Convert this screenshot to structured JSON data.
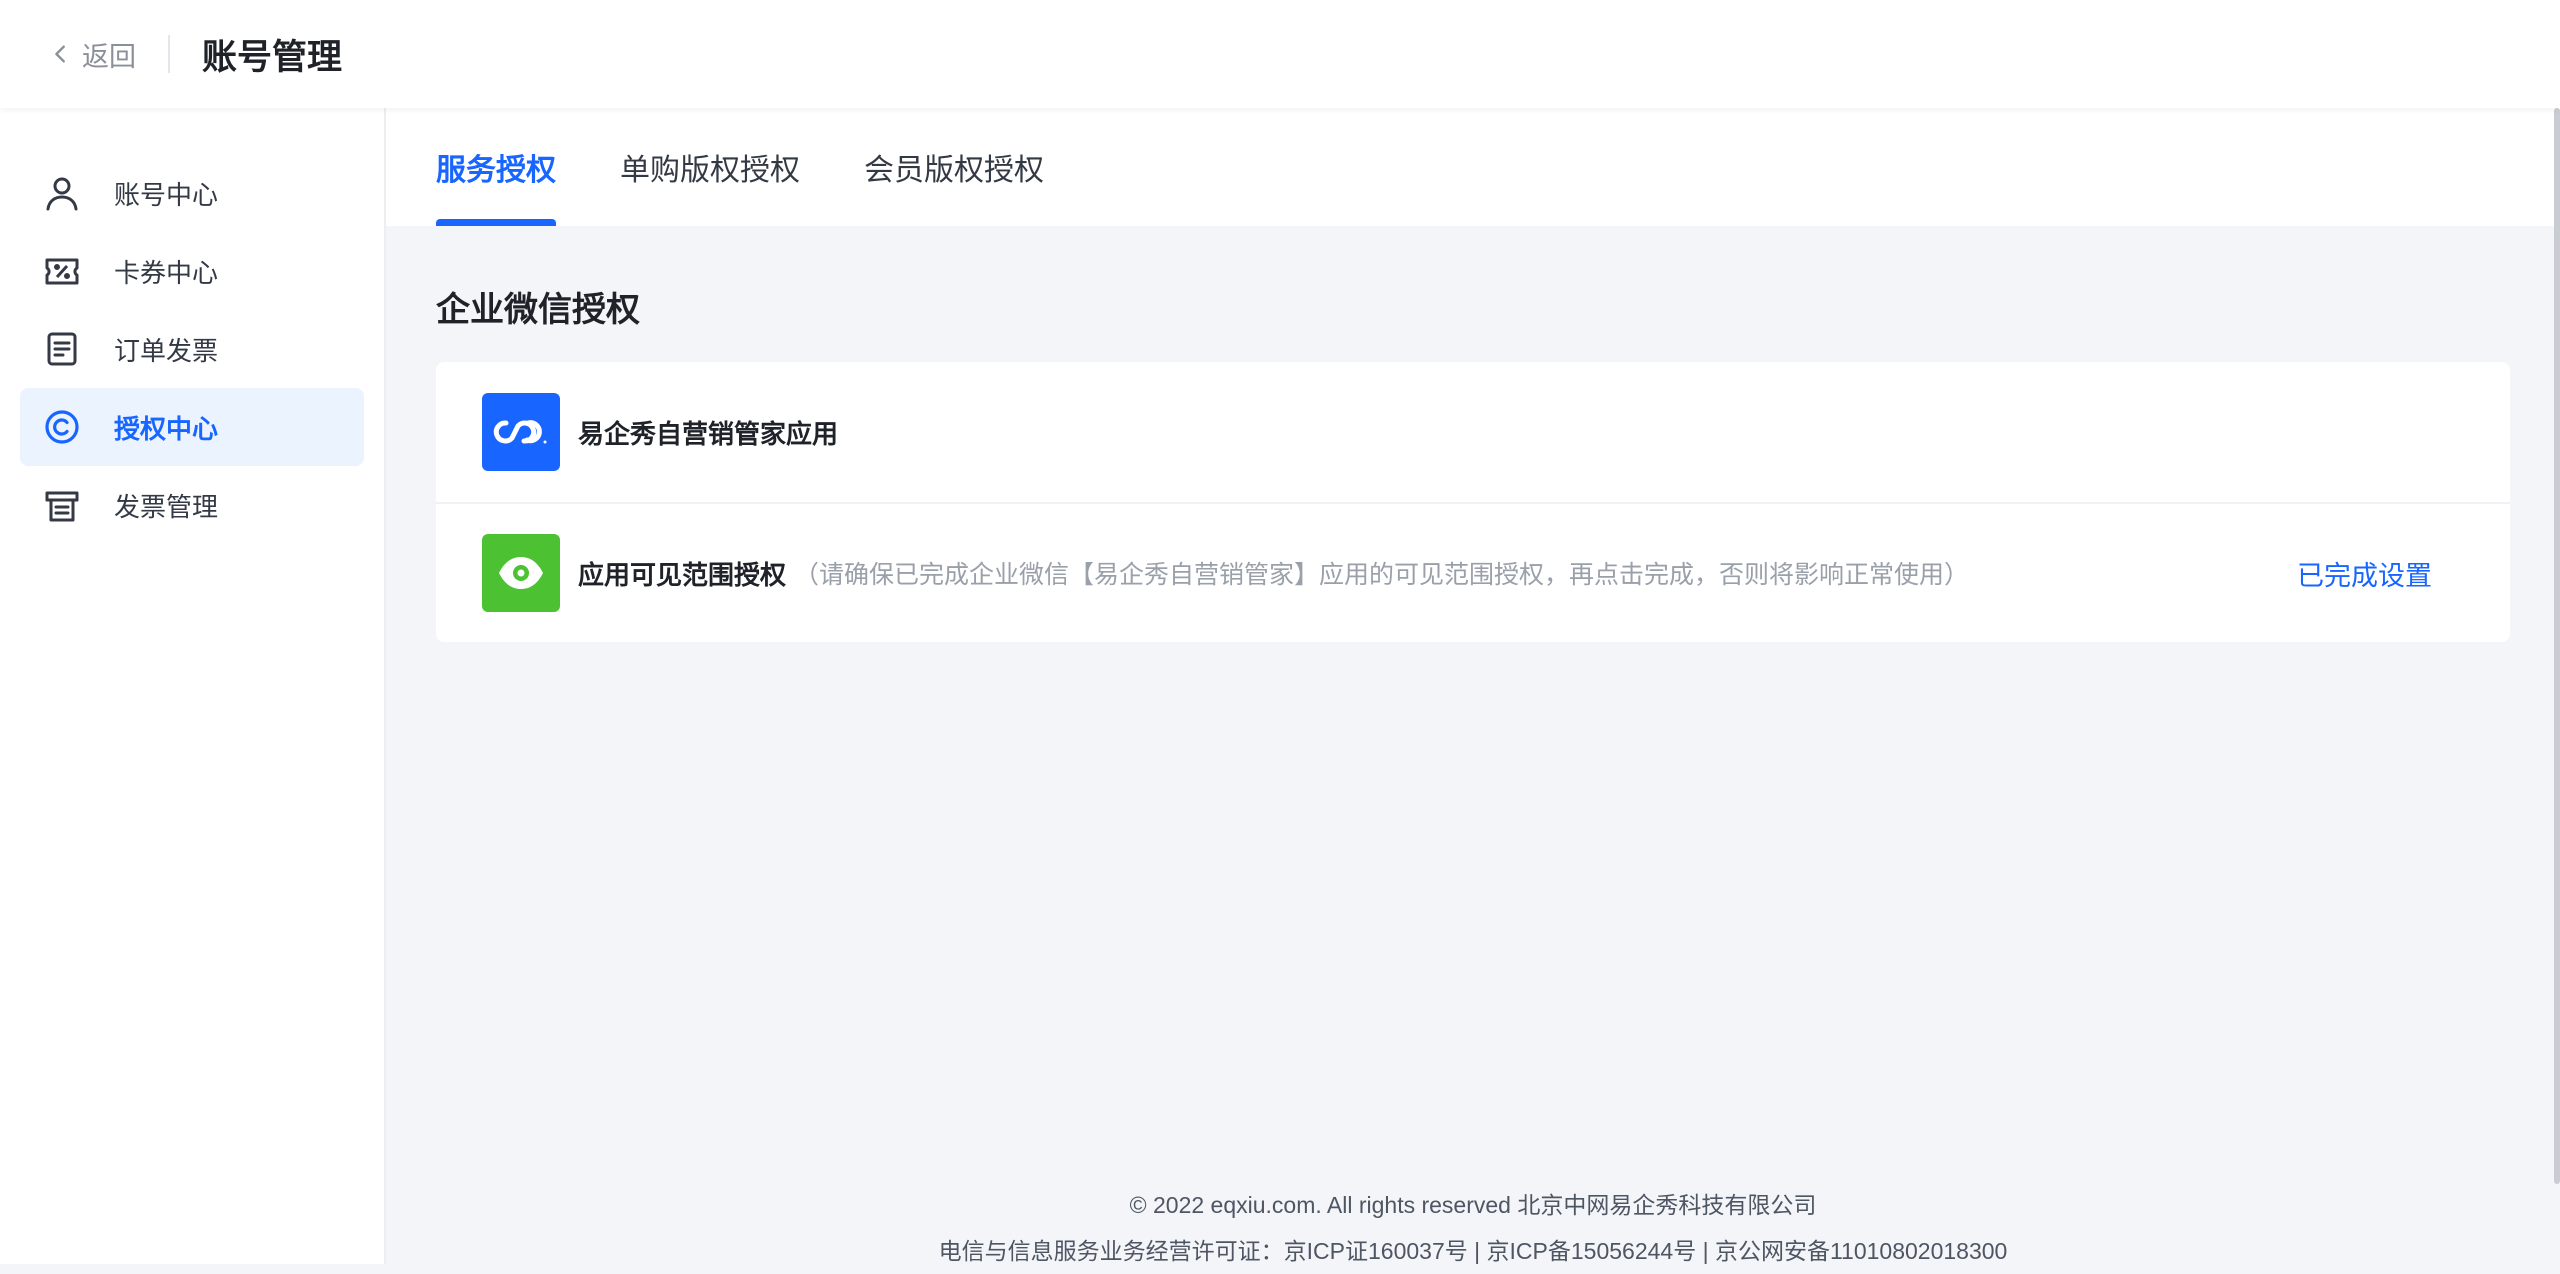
{
  "header": {
    "back_label": "返回",
    "title": "账号管理"
  },
  "sidebar": {
    "items": [
      {
        "label": "账号中心",
        "icon": "user-icon"
      },
      {
        "label": "卡券中心",
        "icon": "ticket-icon"
      },
      {
        "label": "订单发票",
        "icon": "order-icon"
      },
      {
        "label": "授权中心",
        "icon": "copyright-icon",
        "active": true
      },
      {
        "label": "发票管理",
        "icon": "invoice-icon"
      }
    ]
  },
  "tabs": [
    {
      "label": "服务授权",
      "active": true
    },
    {
      "label": "单购版权授权"
    },
    {
      "label": "会员版权授权"
    }
  ],
  "section": {
    "title": "企业微信授权",
    "rows": [
      {
        "title": "易企秀自营销管家应用",
        "icon": "eqxiu-logo-icon"
      },
      {
        "title": "应用可见范围授权",
        "note": "（请确保已完成企业微信【易企秀自营销管家】应用的可见范围授权，再点击完成，否则将影响正常使用）",
        "action": "已完成设置",
        "icon": "eye-icon"
      }
    ]
  },
  "footer": {
    "line1": "© 2022 eqxiu.com. All rights reserved 北京中网易企秀科技有限公司",
    "line2": "电信与信息服务业务经营许可证：京ICP证160037号 | 京ICP备15056244号 | 京公网安备11010802018300"
  },
  "colors": {
    "accent": "#1866ff",
    "green": "#4cc232",
    "active_bg": "#ebf3ff"
  }
}
